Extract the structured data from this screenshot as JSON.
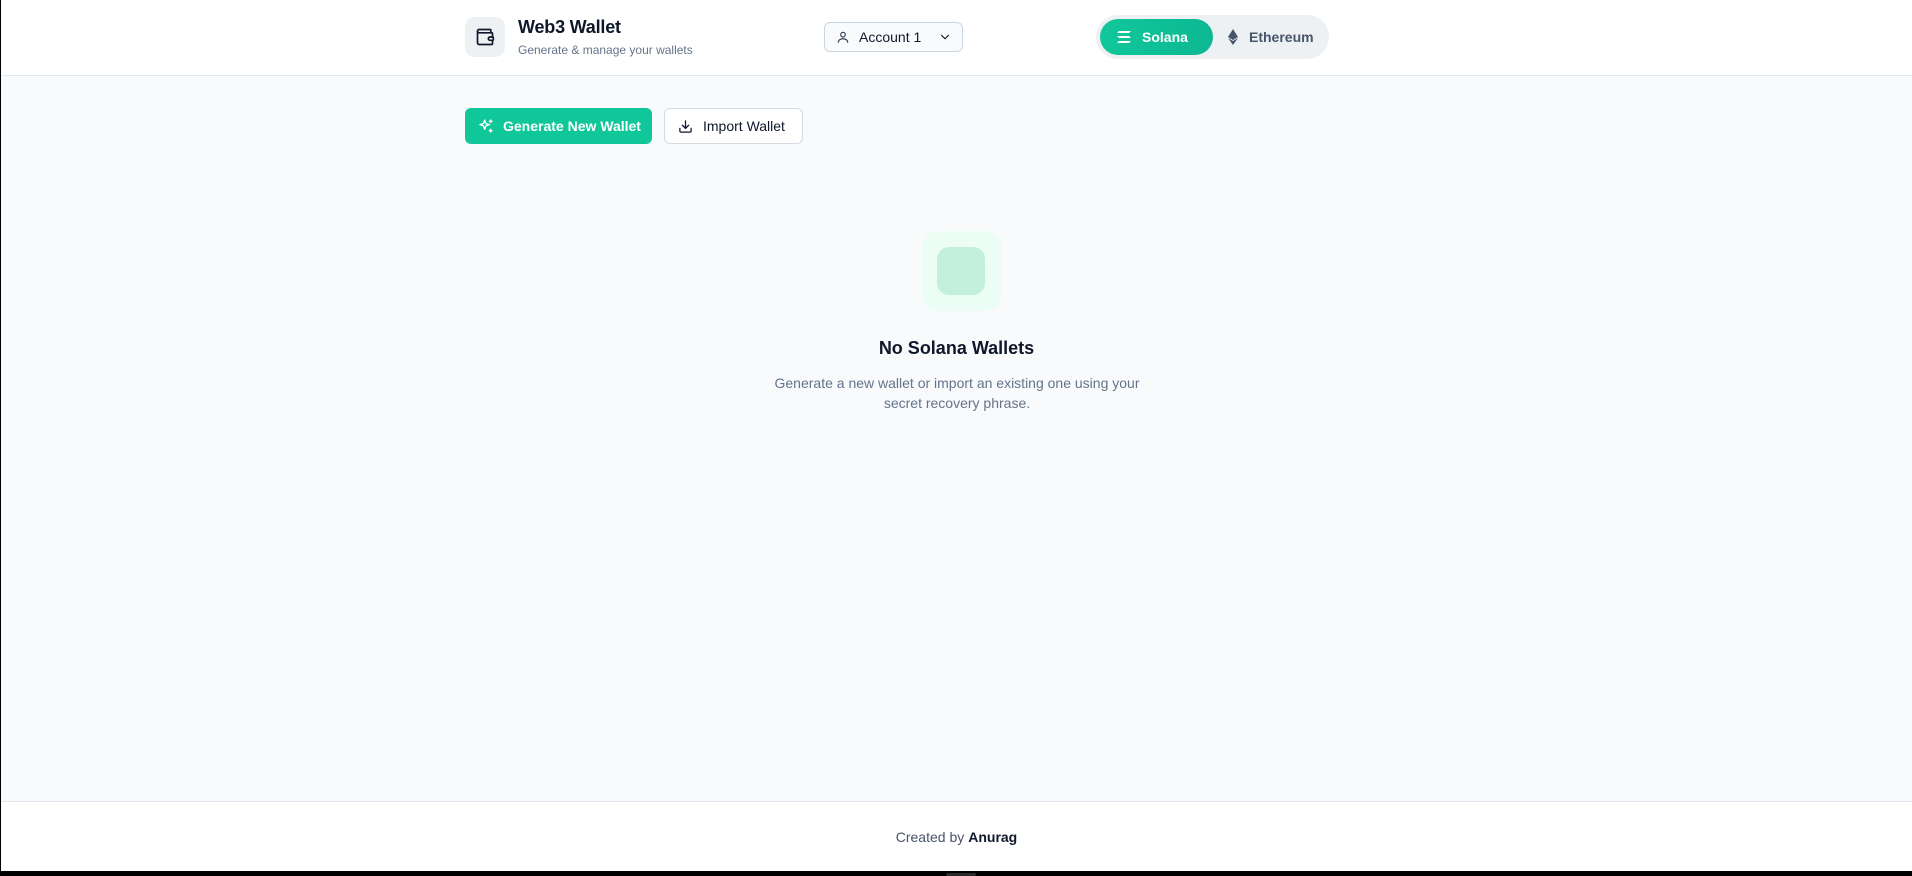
{
  "header": {
    "title": "Web3 Wallet",
    "subtitle": "Generate & manage your wallets",
    "account": {
      "selected": "Account 1"
    },
    "networks": [
      {
        "label": "Solana",
        "active": true,
        "icon": "solana-icon"
      },
      {
        "label": "Ethereum",
        "active": false,
        "icon": "ethereum-icon"
      }
    ]
  },
  "actions": {
    "generate_label": "Generate New Wallet",
    "import_label": "Import Wallet"
  },
  "empty_state": {
    "title": "No Solana Wallets",
    "description": "Generate a new wallet or import an existing one using your secret recovery phrase."
  },
  "footer": {
    "prefix": "Created by",
    "author": "Anurag"
  },
  "colors": {
    "accent": "#10c79a",
    "background": "#f8fafc",
    "text": "#0f172a",
    "muted": "#64748b"
  }
}
